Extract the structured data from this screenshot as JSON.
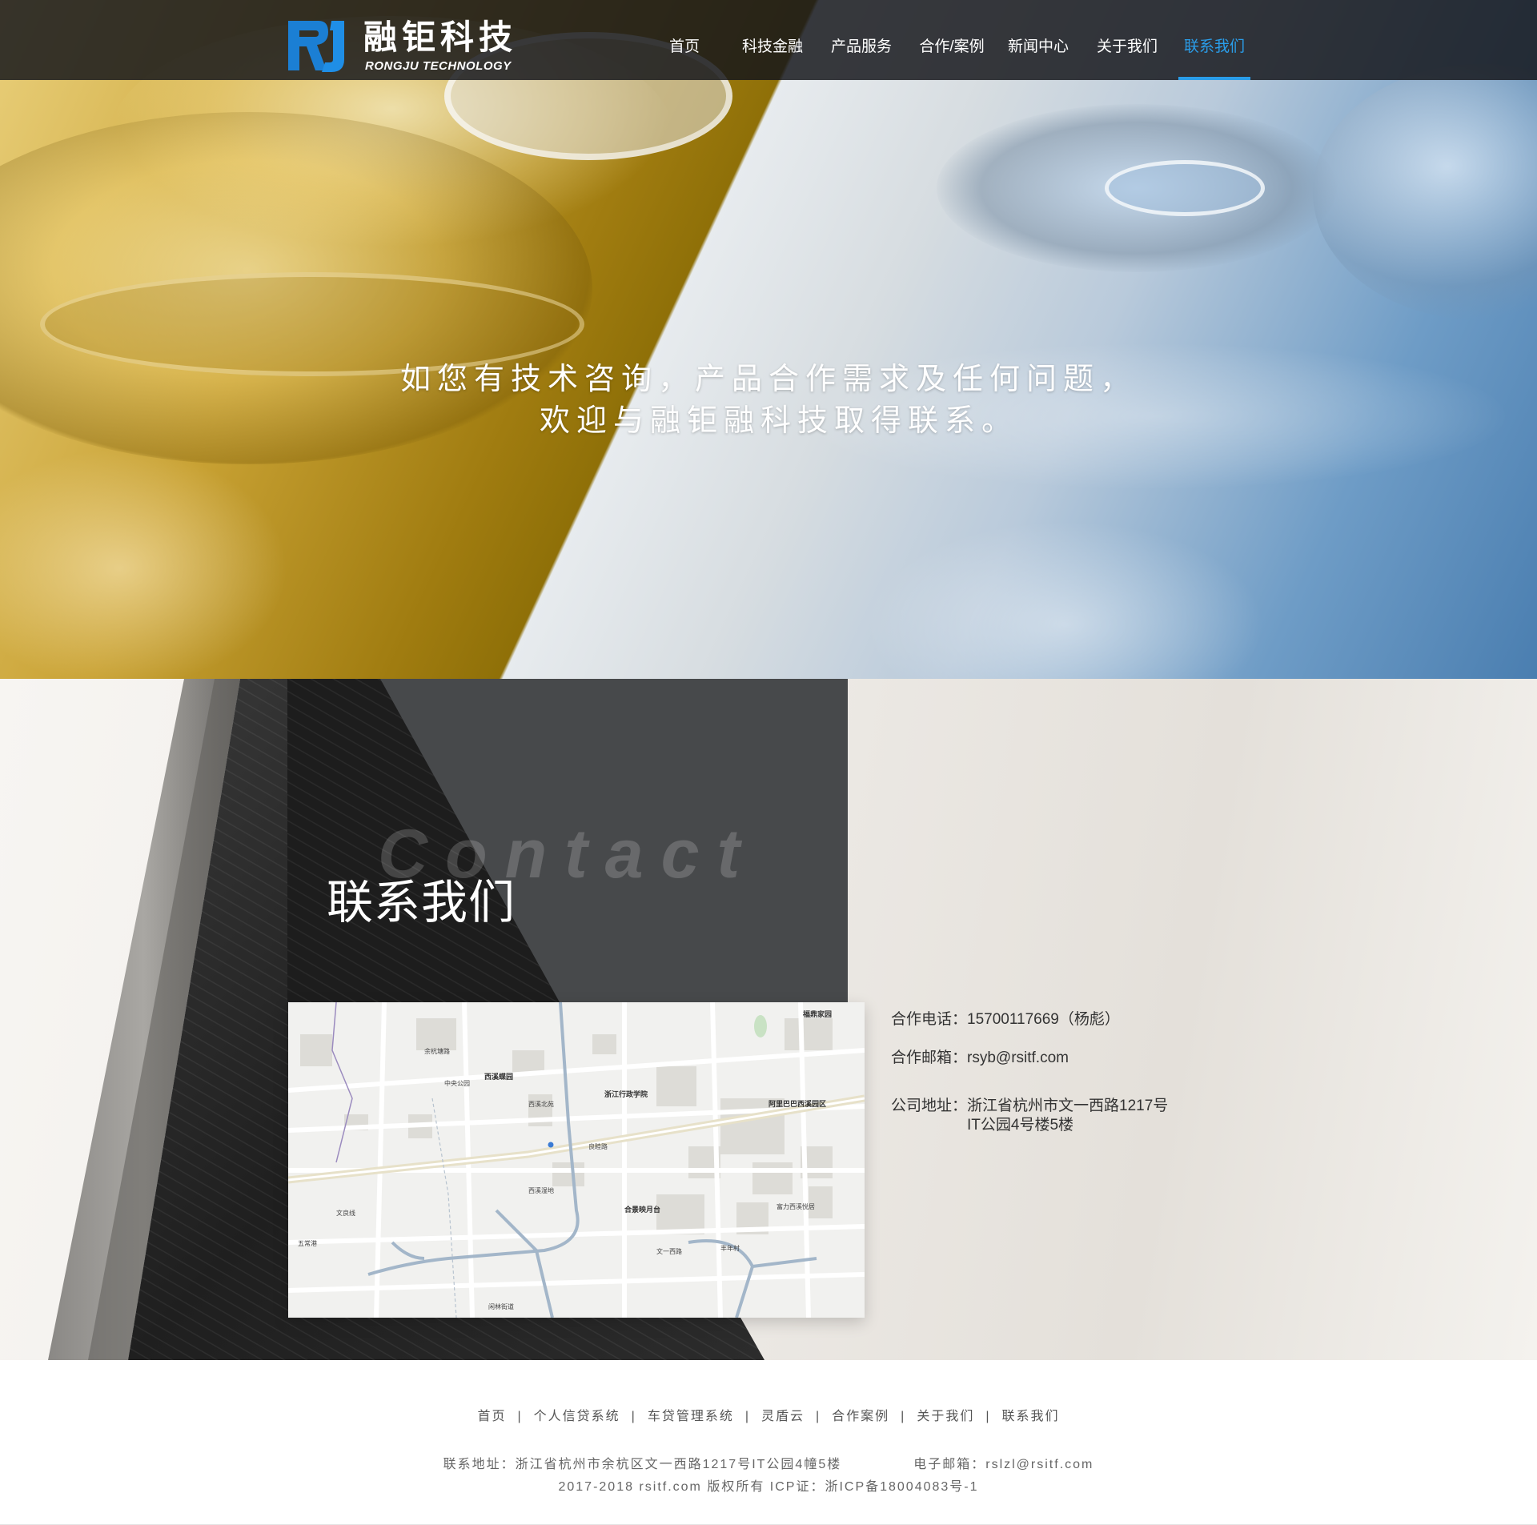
{
  "header": {
    "logo_cn": "融钜科技",
    "logo_en": "RONGJU TECHNOLOGY",
    "nav": [
      {
        "label": "首页",
        "active": false
      },
      {
        "label": "科技金融",
        "active": false
      },
      {
        "label": "产品服务",
        "active": false
      },
      {
        "label": "合作/案例",
        "active": false
      },
      {
        "label": "新闻中心",
        "active": false
      },
      {
        "label": "关于我们",
        "active": false
      },
      {
        "label": "联系我们",
        "active": true
      }
    ]
  },
  "hero": {
    "line1": "如您有技术咨询，产品合作需求及任何问题，",
    "line2": "欢迎与融钜融科技取得联系。"
  },
  "contact": {
    "bg_word": "Contact",
    "title": "联系我们",
    "phone_label": "合作电话：",
    "phone_value": "15700117669（杨彪）",
    "email_label": "合作邮箱：",
    "email_value": "rsyb@rsitf.com",
    "address_label": "公司地址：",
    "address_line1": "浙江省杭州市文一西路1217号",
    "address_line2": "IT公园4号楼5楼"
  },
  "map": {
    "labels": {
      "a": "福鼎家园",
      "b": "余杭塘路",
      "c": "西溪蝶园",
      "d": "浙江行政学院",
      "e": "阿里巴巴西溪园区",
      "f": "合景映月台",
      "g": "文一西路",
      "h": "良睦路",
      "i": "西溪湿地",
      "j": "中央公园",
      "k": "文良线",
      "l": "丰年村",
      "m": "五常港",
      "n": "西溪北苑",
      "o": "富力西溪悦居",
      "p": "闲林街道"
    }
  },
  "footer": {
    "links": [
      "首页",
      "个人信贷系统",
      "车贷管理系统",
      "灵盾云",
      "合作案例",
      "关于我们",
      "联系我们"
    ],
    "separator": "|",
    "address": "联系地址：浙江省杭州市余杭区文一西路1217号IT公园4幢5楼",
    "email": "电子邮箱：rslzl@rsitf.com",
    "copyright": "2017-2018 rsitf.com 版权所有 ICP证：浙ICP备18004083号-1"
  },
  "colors": {
    "accent": "#2a9de9",
    "nav_bg": "#14161a",
    "panel": "#47494b"
  }
}
